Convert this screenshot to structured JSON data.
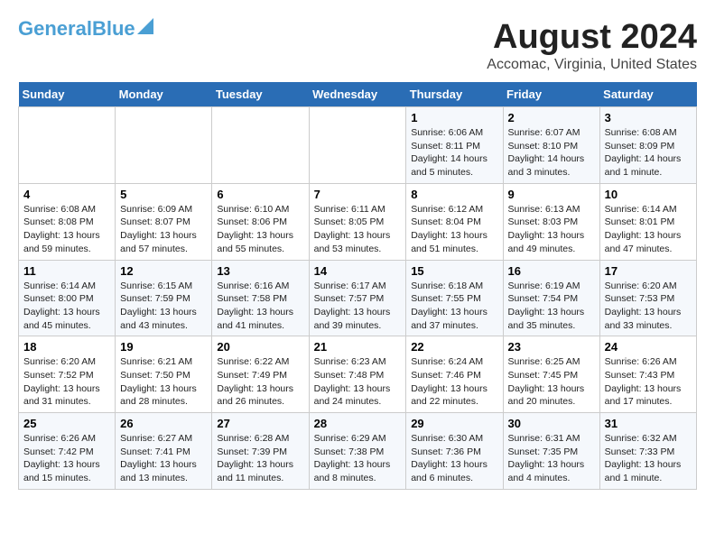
{
  "header": {
    "logo_line1": "General",
    "logo_line2": "Blue",
    "title": "August 2024",
    "subtitle": "Accomac, Virginia, United States"
  },
  "weekdays": [
    "Sunday",
    "Monday",
    "Tuesday",
    "Wednesday",
    "Thursday",
    "Friday",
    "Saturday"
  ],
  "weeks": [
    [
      {
        "day": "",
        "detail": ""
      },
      {
        "day": "",
        "detail": ""
      },
      {
        "day": "",
        "detail": ""
      },
      {
        "day": "",
        "detail": ""
      },
      {
        "day": "1",
        "detail": "Sunrise: 6:06 AM\nSunset: 8:11 PM\nDaylight: 14 hours\nand 5 minutes."
      },
      {
        "day": "2",
        "detail": "Sunrise: 6:07 AM\nSunset: 8:10 PM\nDaylight: 14 hours\nand 3 minutes."
      },
      {
        "day": "3",
        "detail": "Sunrise: 6:08 AM\nSunset: 8:09 PM\nDaylight: 14 hours\nand 1 minute."
      }
    ],
    [
      {
        "day": "4",
        "detail": "Sunrise: 6:08 AM\nSunset: 8:08 PM\nDaylight: 13 hours\nand 59 minutes."
      },
      {
        "day": "5",
        "detail": "Sunrise: 6:09 AM\nSunset: 8:07 PM\nDaylight: 13 hours\nand 57 minutes."
      },
      {
        "day": "6",
        "detail": "Sunrise: 6:10 AM\nSunset: 8:06 PM\nDaylight: 13 hours\nand 55 minutes."
      },
      {
        "day": "7",
        "detail": "Sunrise: 6:11 AM\nSunset: 8:05 PM\nDaylight: 13 hours\nand 53 minutes."
      },
      {
        "day": "8",
        "detail": "Sunrise: 6:12 AM\nSunset: 8:04 PM\nDaylight: 13 hours\nand 51 minutes."
      },
      {
        "day": "9",
        "detail": "Sunrise: 6:13 AM\nSunset: 8:03 PM\nDaylight: 13 hours\nand 49 minutes."
      },
      {
        "day": "10",
        "detail": "Sunrise: 6:14 AM\nSunset: 8:01 PM\nDaylight: 13 hours\nand 47 minutes."
      }
    ],
    [
      {
        "day": "11",
        "detail": "Sunrise: 6:14 AM\nSunset: 8:00 PM\nDaylight: 13 hours\nand 45 minutes."
      },
      {
        "day": "12",
        "detail": "Sunrise: 6:15 AM\nSunset: 7:59 PM\nDaylight: 13 hours\nand 43 minutes."
      },
      {
        "day": "13",
        "detail": "Sunrise: 6:16 AM\nSunset: 7:58 PM\nDaylight: 13 hours\nand 41 minutes."
      },
      {
        "day": "14",
        "detail": "Sunrise: 6:17 AM\nSunset: 7:57 PM\nDaylight: 13 hours\nand 39 minutes."
      },
      {
        "day": "15",
        "detail": "Sunrise: 6:18 AM\nSunset: 7:55 PM\nDaylight: 13 hours\nand 37 minutes."
      },
      {
        "day": "16",
        "detail": "Sunrise: 6:19 AM\nSunset: 7:54 PM\nDaylight: 13 hours\nand 35 minutes."
      },
      {
        "day": "17",
        "detail": "Sunrise: 6:20 AM\nSunset: 7:53 PM\nDaylight: 13 hours\nand 33 minutes."
      }
    ],
    [
      {
        "day": "18",
        "detail": "Sunrise: 6:20 AM\nSunset: 7:52 PM\nDaylight: 13 hours\nand 31 minutes."
      },
      {
        "day": "19",
        "detail": "Sunrise: 6:21 AM\nSunset: 7:50 PM\nDaylight: 13 hours\nand 28 minutes."
      },
      {
        "day": "20",
        "detail": "Sunrise: 6:22 AM\nSunset: 7:49 PM\nDaylight: 13 hours\nand 26 minutes."
      },
      {
        "day": "21",
        "detail": "Sunrise: 6:23 AM\nSunset: 7:48 PM\nDaylight: 13 hours\nand 24 minutes."
      },
      {
        "day": "22",
        "detail": "Sunrise: 6:24 AM\nSunset: 7:46 PM\nDaylight: 13 hours\nand 22 minutes."
      },
      {
        "day": "23",
        "detail": "Sunrise: 6:25 AM\nSunset: 7:45 PM\nDaylight: 13 hours\nand 20 minutes."
      },
      {
        "day": "24",
        "detail": "Sunrise: 6:26 AM\nSunset: 7:43 PM\nDaylight: 13 hours\nand 17 minutes."
      }
    ],
    [
      {
        "day": "25",
        "detail": "Sunrise: 6:26 AM\nSunset: 7:42 PM\nDaylight: 13 hours\nand 15 minutes."
      },
      {
        "day": "26",
        "detail": "Sunrise: 6:27 AM\nSunset: 7:41 PM\nDaylight: 13 hours\nand 13 minutes."
      },
      {
        "day": "27",
        "detail": "Sunrise: 6:28 AM\nSunset: 7:39 PM\nDaylight: 13 hours\nand 11 minutes."
      },
      {
        "day": "28",
        "detail": "Sunrise: 6:29 AM\nSunset: 7:38 PM\nDaylight: 13 hours\nand 8 minutes."
      },
      {
        "day": "29",
        "detail": "Sunrise: 6:30 AM\nSunset: 7:36 PM\nDaylight: 13 hours\nand 6 minutes."
      },
      {
        "day": "30",
        "detail": "Sunrise: 6:31 AM\nSunset: 7:35 PM\nDaylight: 13 hours\nand 4 minutes."
      },
      {
        "day": "31",
        "detail": "Sunrise: 6:32 AM\nSunset: 7:33 PM\nDaylight: 13 hours\nand 1 minute."
      }
    ]
  ]
}
